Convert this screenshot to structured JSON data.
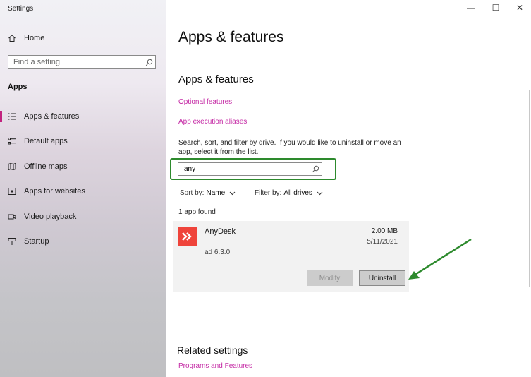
{
  "window": {
    "title": "Settings",
    "controls": {
      "minimize": "—",
      "maximize": "☐",
      "close": "✕"
    }
  },
  "sidebar": {
    "home_label": "Home",
    "search_placeholder": "Find a setting",
    "section_label": "Apps",
    "items": [
      {
        "label": "Apps & features",
        "icon": "list-icon",
        "active": true
      },
      {
        "label": "Default apps",
        "icon": "default-apps-icon",
        "active": false
      },
      {
        "label": "Offline maps",
        "icon": "map-icon",
        "active": false
      },
      {
        "label": "Apps for websites",
        "icon": "window-link-icon",
        "active": false
      },
      {
        "label": "Video playback",
        "icon": "video-icon",
        "active": false
      },
      {
        "label": "Startup",
        "icon": "startup-icon",
        "active": false
      }
    ]
  },
  "main": {
    "page_title": "Apps & features",
    "section_title": "Apps & features",
    "links": {
      "optional_features": "Optional features",
      "execution_aliases": "App execution aliases"
    },
    "description": "Search, sort, and filter by drive. If you would like to uninstall or move an app, select it from the list.",
    "search_value": "any",
    "sort_label": "Sort by:",
    "sort_value": "Name",
    "filter_label": "Filter by:",
    "filter_value": "All drives",
    "found_text": "1 app found",
    "app": {
      "name": "AnyDesk",
      "size": "2.00 MB",
      "date": "5/11/2021",
      "version": "ad 6.3.0",
      "modify_label": "Modify",
      "uninstall_label": "Uninstall"
    },
    "related_title": "Related settings",
    "programs_link": "Programs and Features"
  },
  "colors": {
    "accent": "#c2227e",
    "link": "#c428a4",
    "highlight_green": "#2d8a2d",
    "anydesk_red": "#ef443b"
  }
}
